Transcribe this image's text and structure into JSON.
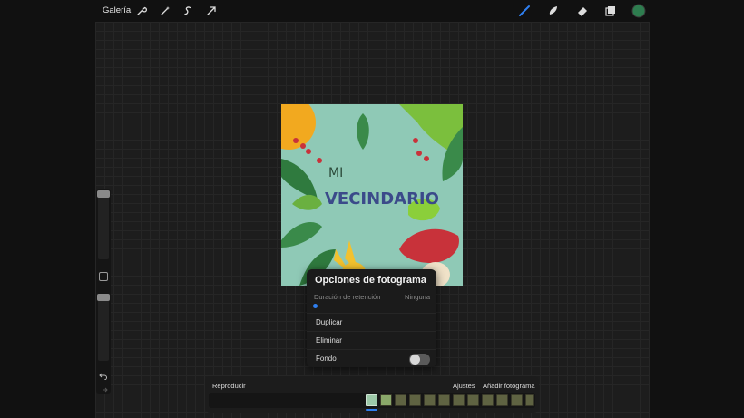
{
  "topbar": {
    "gallery_label": "Galería",
    "left_tools": [
      "wrench-icon",
      "magic-wand-icon",
      "selection-icon",
      "transform-arrow-icon"
    ],
    "right_tools": [
      "brush-icon",
      "smudge-icon",
      "eraser-icon",
      "layers-icon",
      "color-icon"
    ],
    "accent_color": "#2f7ff0",
    "current_color": "#2e7d4f"
  },
  "sidebar": {
    "size_slider_level": 0.0,
    "opacity_slider_level": 0.0,
    "undo_icon": "undo-icon",
    "redo_icon": "redo-icon"
  },
  "artwork": {
    "title_line1": "MI",
    "title_line2": "VECINDARIO"
  },
  "frame_options": {
    "title": "Opciones de fotograma",
    "hold_label": "Duración de retención",
    "hold_value": "Ninguna",
    "hold_level": 0,
    "duplicate_label": "Duplicar",
    "delete_label": "Eliminar",
    "background_label": "Fondo",
    "background_on": false
  },
  "timeline": {
    "play_label": "Reproducir",
    "settings_label": "Ajustes",
    "add_frame_label": "Añadir fotograma",
    "frame_count": 12,
    "selected_frame": 1
  }
}
